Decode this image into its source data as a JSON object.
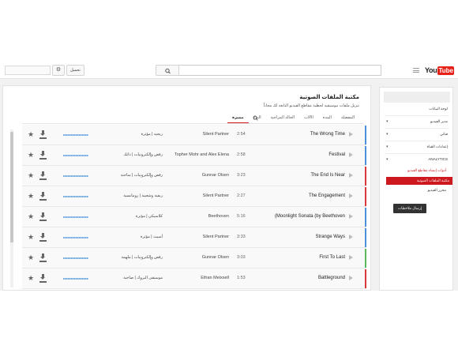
{
  "header": {
    "upload_label": "تحميل",
    "search_placeholder": "",
    "logo_you": "You",
    "logo_tube": "Tube"
  },
  "library": {
    "title": "مكتبة الملفات الصوتية",
    "subtitle": "تنزيل ملفات موسيقية لحظية مقاطع الفيديو التابعة لك مجاناً",
    "tabs": [
      {
        "label": "مميزة",
        "active": true
      },
      {
        "label": "النوع",
        "active": false
      },
      {
        "label": "الحالة المزاجية",
        "active": false
      },
      {
        "label": "الآلات",
        "active": false
      },
      {
        "label": "المدة",
        "active": false
      },
      {
        "label": "المفضلة",
        "active": false
      }
    ]
  },
  "tracks": [
    {
      "name": "The Wrong Time",
      "duration": "2:54",
      "artist": "Silent Partner",
      "genre": "ريجيه | مؤثرة",
      "color": "#4a90d9"
    },
    {
      "name": "Festival",
      "duration": "2:58",
      "artist": "Topher Mohr and Alex Elena",
      "genre": "رقص وإلكترونيات | ذاتك",
      "color": "#4a90d9"
    },
    {
      "name": "The End Is Near",
      "duration": "3:23",
      "artist": "Gunnar Olsen",
      "genre": "رقص وإلكترونيات | ساخنة",
      "color": "#d9383a"
    },
    {
      "name": "The Engagement",
      "duration": "2:27",
      "artist": "Silent Partner",
      "genre": "ريفية وشعبية | رومانسية",
      "color": "#d9383a"
    },
    {
      "name": "(Moonlight Sonata (by Beethoven",
      "duration": "5:16",
      "artist": "Beethoven",
      "genre": "كلاسيكي | مؤثرة",
      "color": "#4a90d9"
    },
    {
      "name": "Strange Ways",
      "duration": "3:33",
      "artist": "Silent Partner",
      "genre": "أسيث | مؤثرة",
      "color": "#4a90d9"
    },
    {
      "name": "First To Last",
      "duration": "3:03",
      "artist": "Gunnar Olsen",
      "genre": "رقص وإلكترونيات | ملهمة",
      "color": "#5cb85c"
    },
    {
      "name": "Battleground",
      "duration": "1:53",
      "artist": "Ethan Meixsell",
      "genre": "موسيقى البروك | صاخبة",
      "color": "#d9383a"
    }
  ],
  "sidebar": {
    "dashboard": "لوحة البيانات",
    "video_manager": "مدير الفيديو",
    "channel": "قناتي",
    "settings": "إعدادات القناة",
    "analytics": "ANALYTICS",
    "sub_create": "أدوات إنشاء مقاطع الفيديو",
    "sub_active": "مكتبة الملفات الصوتية",
    "sub_editor": "محرر الفيديو",
    "feedback": "إرسال ملاحظات"
  }
}
